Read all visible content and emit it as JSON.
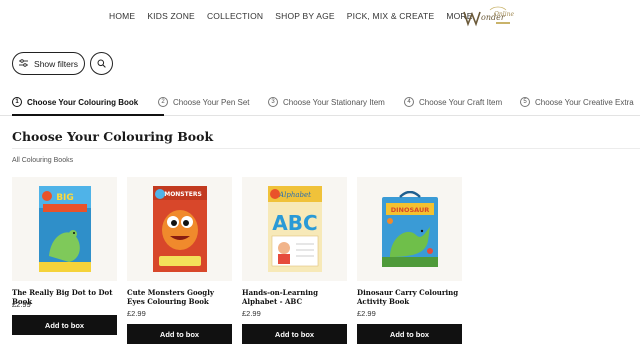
{
  "nav": {
    "links": [
      "HOME",
      "KIDS ZONE",
      "COLLECTION",
      "SHOP BY AGE",
      "PICK, MIX & CREATE",
      "MORE"
    ],
    "logo": "Wonderful Online"
  },
  "toolbar": {
    "filters_label": "Show filters",
    "filters_icon": "sliders-icon",
    "search_icon": "search-icon"
  },
  "steps": [
    {
      "num": "1",
      "label": "Choose Your Colouring Book",
      "active": true
    },
    {
      "num": "2",
      "label": "Choose Your Pen Set",
      "active": false
    },
    {
      "num": "3",
      "label": "Choose Your Stationary Item",
      "active": false
    },
    {
      "num": "4",
      "label": "Choose Your Craft Item",
      "active": false
    },
    {
      "num": "5",
      "label": "Choose Your Creative Extra",
      "active": false
    }
  ],
  "section": {
    "title": "Choose Your Colouring Book",
    "category": "All Colouring Books"
  },
  "products": [
    {
      "name": "The Really Big Dot to Dot Book",
      "price": "£2.99",
      "button": "Add to box",
      "cover_color": "#2f8fc9"
    },
    {
      "name": "Cute Monsters Googly Eyes Colouring Book",
      "price": "£2.99",
      "button": "Add to box",
      "cover_color": "#d8472a"
    },
    {
      "name": "Hands-on-Learning Alphabet - ABC",
      "price": "£2.99",
      "button": "Add to box",
      "cover_color": "#f0c23a"
    },
    {
      "name": "Dinosaur Carry Colouring Activity Book",
      "price": "£2.99",
      "button": "Add to box",
      "cover_color": "#3a9bd6"
    }
  ],
  "colors": {
    "accent": "#111111",
    "card_bg": "#f8f6f2"
  }
}
